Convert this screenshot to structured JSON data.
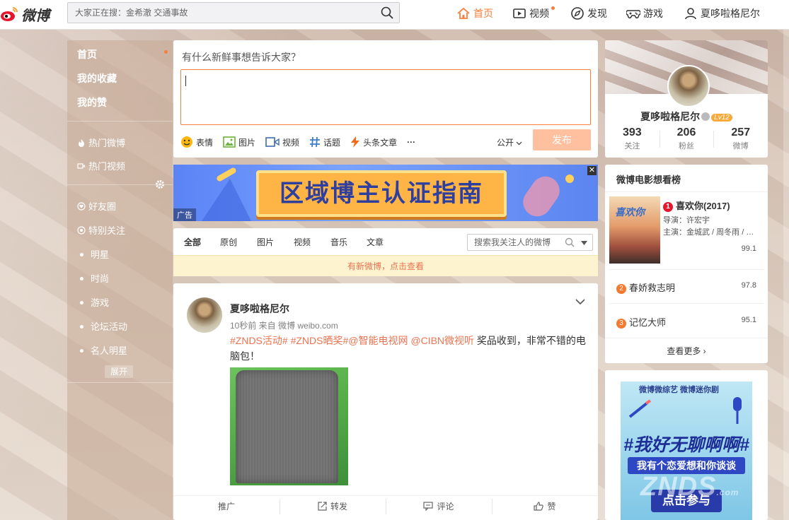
{
  "app": {
    "logo_text": "微博"
  },
  "search": {
    "placeholder": "大家正在搜：金希澈 交通事故"
  },
  "nav": {
    "home": "首页",
    "video": "视频",
    "discover": "发现",
    "game": "游戏",
    "user": "夏哆啦格尼尔"
  },
  "leftnav": {
    "home": "首页",
    "favorites": "我的收藏",
    "likes": "我的赞",
    "hot_weibo": "热门微博",
    "hot_video": "热门视频",
    "friends": "好友圈",
    "special": "特别关注",
    "groups": [
      "明星",
      "时尚",
      "游戏",
      "论坛活动",
      "名人明星"
    ],
    "expand": "展开"
  },
  "publisher": {
    "prompt": "有什么新鲜事想告诉大家？",
    "tools": [
      "表情",
      "图片",
      "视频",
      "话题",
      "头条文章"
    ],
    "more": "···",
    "visibility": "公开",
    "send": "发布"
  },
  "banner": {
    "text": "区域博主认证指南",
    "ad_label": "广告",
    "close": "✕"
  },
  "feed": {
    "tabs": [
      "全部",
      "原创",
      "图片",
      "视频",
      "音乐",
      "文章"
    ],
    "search_placeholder": "搜索我关注人的微博",
    "new_notice": "有新微博，点击查看"
  },
  "post": {
    "author": "夏哆啦格尼尔",
    "meta": "10秒前 来自 微博 weibo.com",
    "topics": "#ZNDS活动# #ZNDS晒奖#@智能电视网 @CIBN微视听",
    "text": " 奖品收到，非常不错的电脑包！",
    "actions": [
      "推广",
      "转发",
      "评论",
      "赞"
    ]
  },
  "profile": {
    "name": "夏哆啦格尼尔",
    "level": "Lv12",
    "following": "393",
    "following_label": "关注",
    "followers": "206",
    "followers_label": "粉丝",
    "weibo": "257",
    "weibo_label": "微博"
  },
  "movies": {
    "title": "微博电影想看榜",
    "items": [
      {
        "rank": "1",
        "name": "喜欢你(2017)",
        "director": "导演：许宏宇",
        "cast": "主演：金城武 / 周冬雨 / 孙艺洲",
        "score": "99.1",
        "poster_text": "喜欢你"
      },
      {
        "rank": "2",
        "name": "春娇救志明",
        "score": "97.8"
      },
      {
        "rank": "3",
        "name": "记忆大师",
        "score": "95.1"
      }
    ],
    "more": "查看更多 ›"
  },
  "ad": {
    "logos": "微博微综艺  微博迷你剧",
    "headline": "#我好无聊啊啊#",
    "band": "我有个恋爱想和你谈谈",
    "button": "点击参与"
  },
  "watermark": {
    "text": "ZNDS",
    "small": ".com"
  },
  "colors": {
    "accent": "#fa7d3c",
    "topic": "#eb7350",
    "send_disabled": "#ffc09f",
    "rank1": "#e6162d",
    "rank2": "#f47a30",
    "rank3": "#f47a30"
  }
}
